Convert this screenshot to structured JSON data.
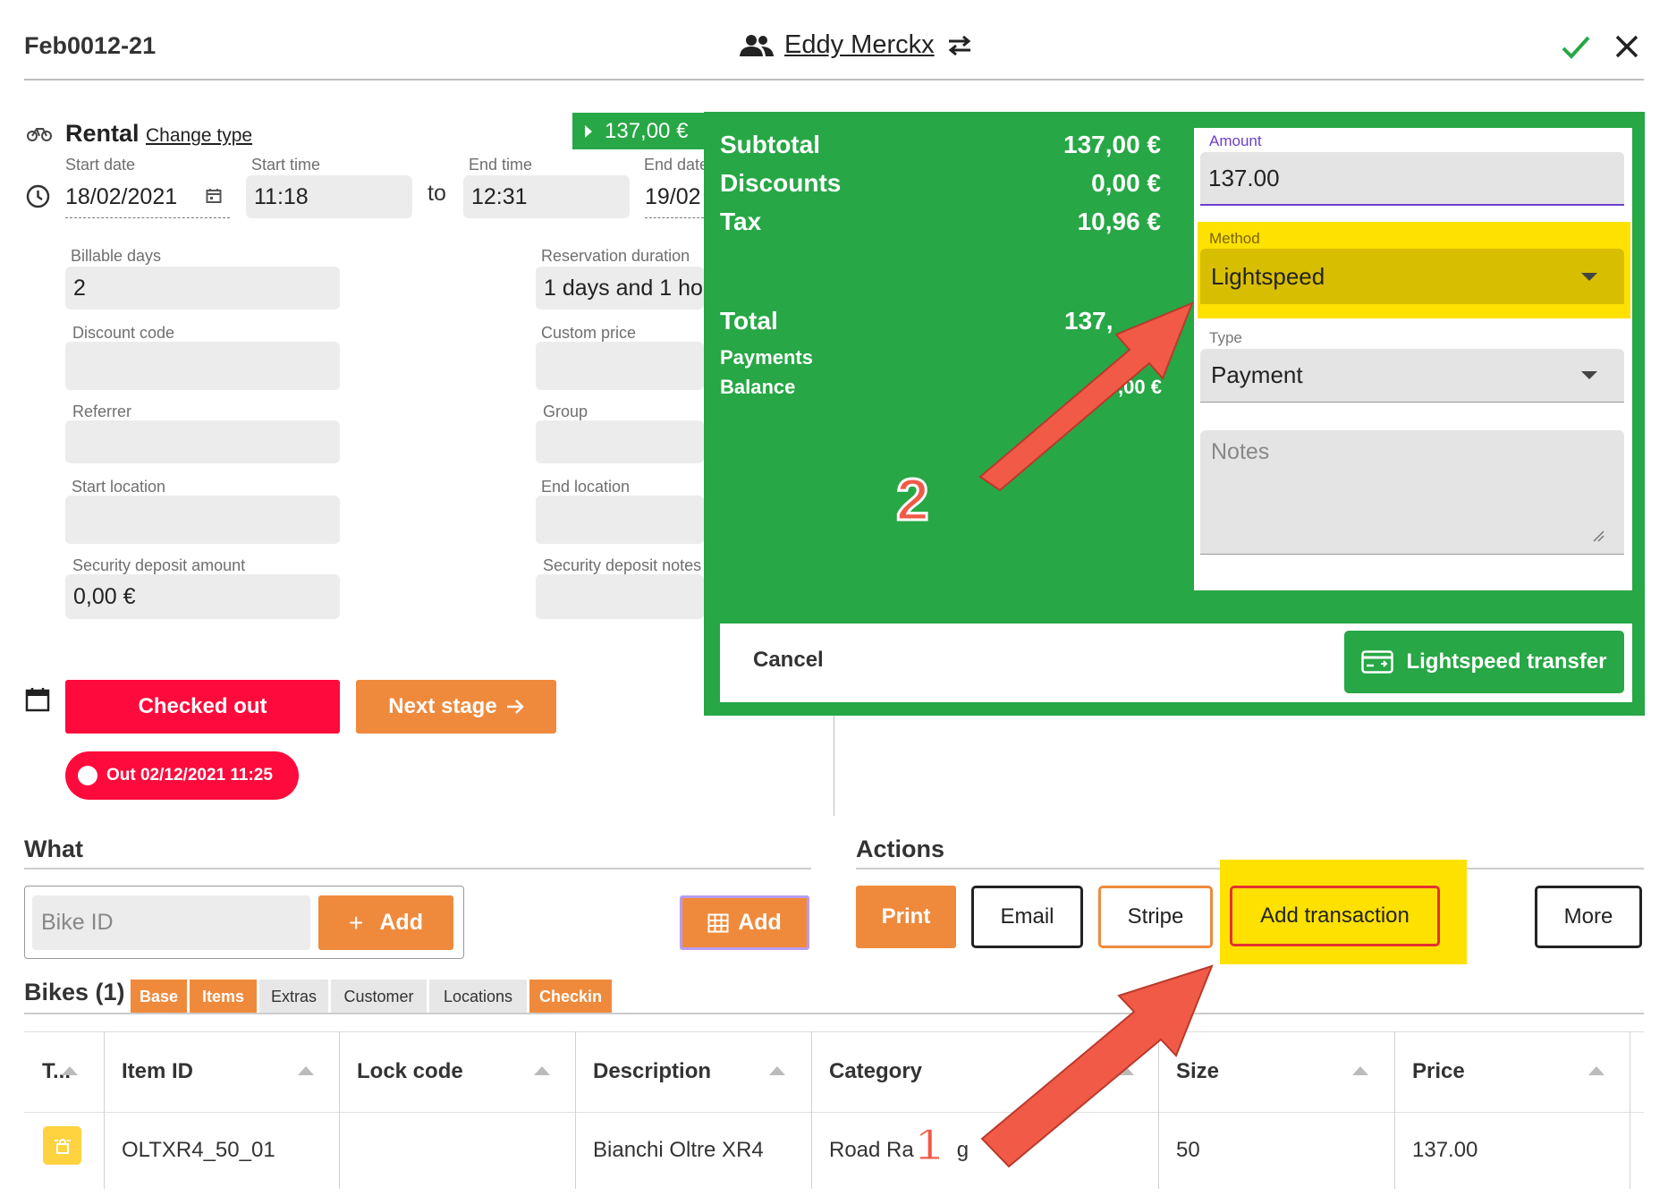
{
  "header": {
    "booking_id": "Feb0012-21",
    "customer_name": "Eddy Merckx"
  },
  "rental": {
    "type_label": "Rental",
    "change_type": "Change type",
    "price_badge": "137,00 €",
    "start_date_label": "Start date",
    "start_date": "18/02/2021",
    "start_time_label": "Start time",
    "start_time": "11:18",
    "to": "to",
    "end_time_label": "End time",
    "end_time": "12:31",
    "end_date_label": "End date",
    "end_date": "19/02",
    "billable_days_label": "Billable days",
    "billable_days": "2",
    "reservation_duration_label": "Reservation duration",
    "reservation_duration": "1 days and 1 hou",
    "discount_code_label": "Discount code",
    "custom_price_label": "Custom price",
    "referrer_label": "Referrer",
    "group_label": "Group",
    "start_location_label": "Start location",
    "end_location_label": "End location",
    "security_deposit_label": "Security deposit amount",
    "security_deposit": "0,00 €",
    "security_notes_label": "Security deposit notes"
  },
  "status": {
    "checked_out": "Checked out",
    "next_stage": "Next stage",
    "out_badge": "Out 02/12/2021 11:25"
  },
  "what": {
    "title": "What",
    "bike_id_placeholder": "Bike ID",
    "add": "Add",
    "grid_add": "Add"
  },
  "actions": {
    "title": "Actions",
    "print": "Print",
    "email": "Email",
    "stripe": "Stripe",
    "add_transaction": "Add transaction",
    "more": "More"
  },
  "bikes": {
    "title": "Bikes (1)",
    "tabs": [
      "Base",
      "Items",
      "Extras",
      "Customer",
      "Locations",
      "Checkin"
    ],
    "columns": [
      "T...",
      "Item ID",
      "Lock code",
      "Description",
      "Category",
      "Size",
      "Price"
    ],
    "rows": [
      {
        "item_id": "OLTXR4_50_01",
        "lock_code": "",
        "description": "Bianchi Oltre XR4",
        "category": "Road Ra",
        "category_tail": "g",
        "size": "50",
        "price": "137.00"
      }
    ]
  },
  "summary": {
    "subtotal_label": "Subtotal",
    "subtotal": "137,00 €",
    "discounts_label": "Discounts",
    "discounts": "0,00 €",
    "tax_label": "Tax",
    "tax": "10,96 €",
    "total_label": "Total",
    "total": "137,",
    "payments_label": "Payments",
    "payments": "",
    "balance_label": "Balance",
    "balance": ",00 €"
  },
  "transaction": {
    "amount_label": "Amount",
    "amount": "137.00",
    "method_label": "Method",
    "method": "Lightspeed",
    "type_label": "Type",
    "type": "Payment",
    "notes_placeholder": "Notes",
    "cancel": "Cancel",
    "submit": "Lightspeed transfer"
  },
  "annotations": {
    "step1": "1",
    "step2": "2"
  },
  "colors": {
    "green": "#27a745",
    "orange": "#ef8a3c",
    "red": "#ff0a3c",
    "highlight": "#ffe100",
    "arrow": "#f15a46"
  }
}
